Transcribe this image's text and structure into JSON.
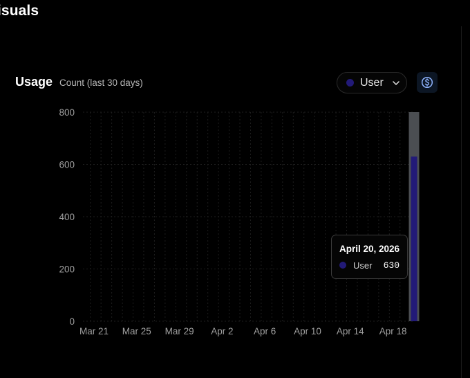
{
  "page": {
    "title": "isuals"
  },
  "usage": {
    "title": "Usage",
    "subtitle": "Count (last 30 days)",
    "series_selector": {
      "selected": "User",
      "color": "#221a78",
      "icon": "chevron-down-icon"
    },
    "currency_button": {
      "icon": "dollar-circle-icon"
    }
  },
  "tooltip": {
    "date": "April 20, 2026",
    "series": "User",
    "value": "630",
    "color": "#221a78"
  },
  "colors": {
    "background": "#000000",
    "grid": "#1e1e1e",
    "highlight_bar": "#4b4e52",
    "series": "#221a78"
  },
  "chart_data": {
    "type": "bar",
    "title": "",
    "xlabel": "",
    "ylabel": "",
    "ylim": [
      0,
      800
    ],
    "yticks": [
      "0",
      "200",
      "400",
      "600",
      "800"
    ],
    "xticks": [
      "Mar 21",
      "Mar 25",
      "Mar 29",
      "Apr 2",
      "Apr 6",
      "Apr 10",
      "Apr 14",
      "Apr 18"
    ],
    "categories": [
      "Mar 21",
      "Mar 22",
      "Mar 23",
      "Mar 24",
      "Mar 25",
      "Mar 26",
      "Mar 27",
      "Mar 28",
      "Mar 29",
      "Mar 30",
      "Mar 31",
      "Apr 1",
      "Apr 2",
      "Apr 3",
      "Apr 4",
      "Apr 5",
      "Apr 6",
      "Apr 7",
      "Apr 8",
      "Apr 9",
      "Apr 10",
      "Apr 11",
      "Apr 12",
      "Apr 13",
      "Apr 14",
      "Apr 15",
      "Apr 16",
      "Apr 17",
      "Apr 18",
      "Apr 19",
      "Apr 20"
    ],
    "series": [
      {
        "name": "User",
        "values": [
          0,
          0,
          0,
          0,
          0,
          0,
          0,
          0,
          0,
          0,
          0,
          0,
          0,
          0,
          0,
          0,
          0,
          0,
          0,
          0,
          0,
          0,
          0,
          0,
          0,
          0,
          0,
          0,
          0,
          0,
          630
        ]
      }
    ],
    "highlighted_category": "Apr 20",
    "grid": true
  }
}
